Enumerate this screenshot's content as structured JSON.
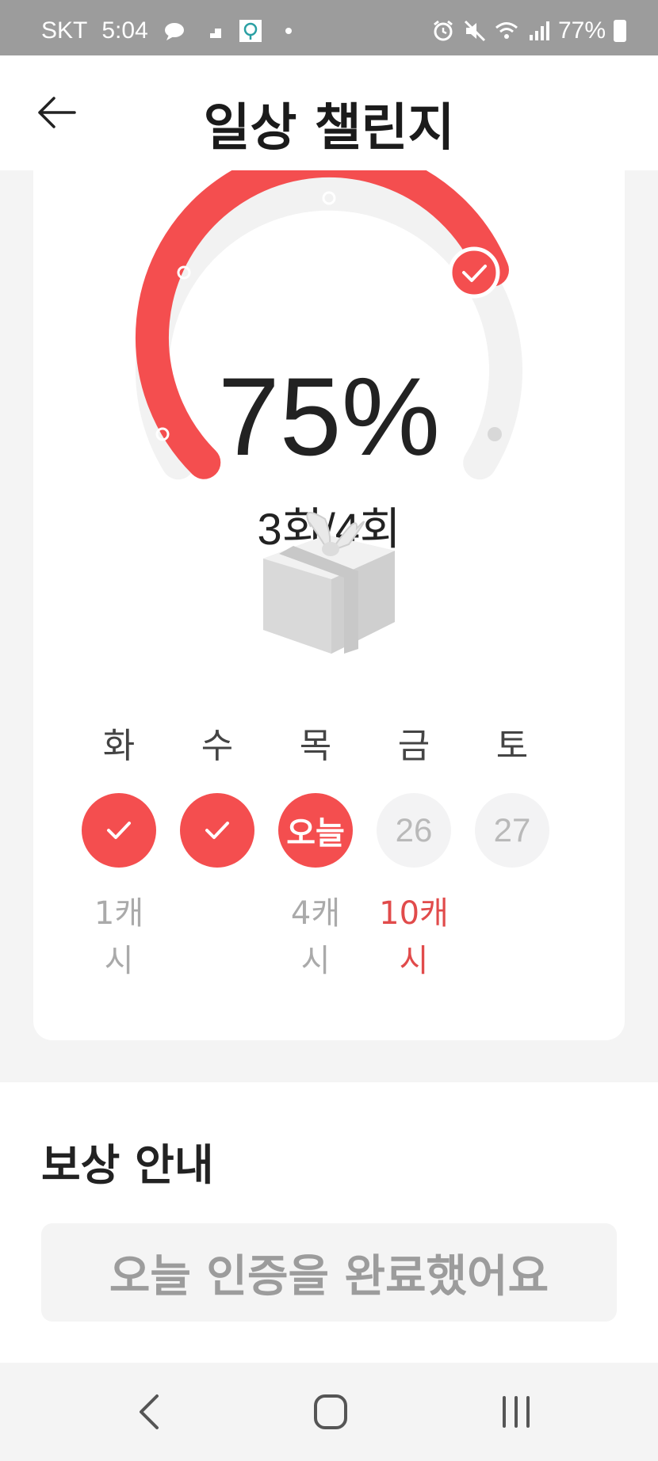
{
  "status_bar": {
    "carrier": "SKT",
    "time": "5:04",
    "battery": "77%"
  },
  "header": {
    "title": "일상 챌린지"
  },
  "progress": {
    "percent_label": "75%",
    "percent_value": 0.75,
    "count_label": "3회/4회"
  },
  "week": [
    {
      "day": "화",
      "state": "done",
      "reward": "1캐시"
    },
    {
      "day": "수",
      "state": "done",
      "reward": ""
    },
    {
      "day": "목",
      "state": "today",
      "circle_label": "오늘",
      "reward": "4캐시"
    },
    {
      "day": "금",
      "state": "future",
      "circle_label": "26",
      "reward": "10캐시"
    },
    {
      "day": "토",
      "state": "future",
      "circle_label": "27",
      "reward": ""
    }
  ],
  "reward_info": {
    "title": "보상 안내",
    "button_label": "오늘 인증을 완료했어요"
  },
  "colors": {
    "accent": "#f44e4f",
    "track": "#f2f2f2"
  }
}
